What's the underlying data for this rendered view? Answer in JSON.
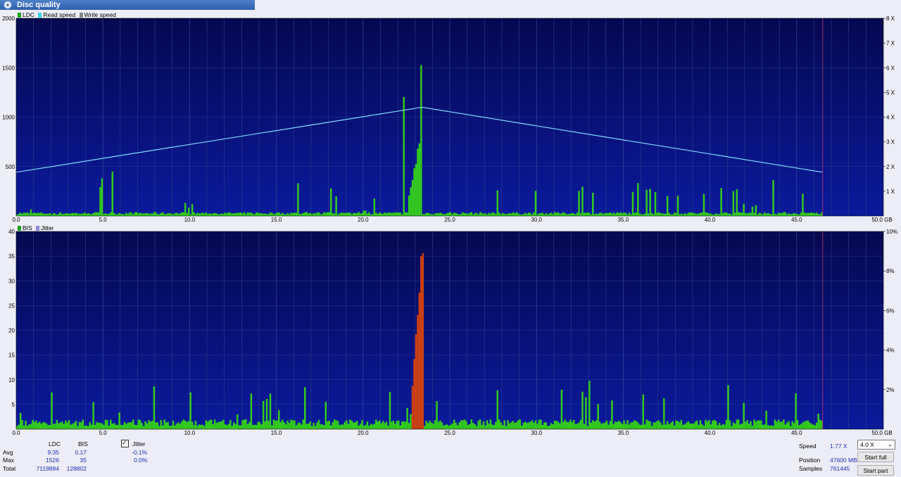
{
  "window": {
    "title": "Disc quality"
  },
  "top_legend": [
    {
      "label": "LDC",
      "color": "#1fa31f"
    },
    {
      "label": "Read speed",
      "color": "#35d6e8"
    },
    {
      "label": "Write speed",
      "color": "#888888"
    }
  ],
  "bottom_legend": [
    {
      "label": "BIS",
      "color": "#1fa31f"
    },
    {
      "label": "Jitter",
      "color": "#8a8ae0"
    }
  ],
  "colors": {
    "plot_bg_top": "#050850",
    "plot_bg_bottom": "#0a1a9c",
    "bars": "#33cc1c",
    "bars_hi": "#d04010",
    "read_line": "#7fdfff",
    "grid": "#2a3f8a",
    "end_marker": "#a0306a"
  },
  "chart_data": [
    {
      "type": "bar",
      "title": "",
      "series": [
        {
          "name": "LDC",
          "values_sampled": [
            80,
            20,
            60,
            30,
            470,
            40,
            60,
            30,
            150,
            40,
            50,
            30,
            40,
            410,
            50,
            380,
            60,
            300,
            1526,
            830,
            340,
            60,
            430,
            330,
            70,
            430,
            100,
            310,
            380,
            250,
            380,
            330,
            260,
            330,
            320,
            180,
            380,
            280,
            50
          ]
        },
        {
          "name": "Read speed",
          "x": [
            0,
            23.4,
            46.5
          ],
          "y": [
            1.77,
            4.4,
            1.77
          ]
        }
      ],
      "x_ticks": [
        "0.0",
        "5.0",
        "10.0",
        "15.0",
        "20.0",
        "25.0",
        "30.0",
        "35.0",
        "40.0",
        "45.0",
        "50.0 GB"
      ],
      "y_ticks_left": [
        "500",
        "1000",
        "1500",
        "2000"
      ],
      "y_ticks_right": [
        "1 X",
        "2 X",
        "3 X",
        "4 X",
        "5 X",
        "6 X",
        "7 X",
        "8 X"
      ],
      "xlim": [
        0,
        50
      ],
      "ylim": [
        0,
        2000
      ],
      "y2lim": [
        0,
        8
      ],
      "data_end_gb": 46.5
    },
    {
      "type": "bar",
      "title": "",
      "series": [
        {
          "name": "BIS",
          "peak": {
            "x": 23.3,
            "value": 35
          }
        }
      ],
      "x_ticks": [
        "0.0",
        "5.0",
        "10.0",
        "15.0",
        "20.0",
        "25.0",
        "30.0",
        "35.0",
        "40.0",
        "45.0",
        "50.0 GB"
      ],
      "y_ticks_left": [
        "5",
        "10",
        "15",
        "20",
        "25",
        "30",
        "35",
        "40"
      ],
      "y_ticks_right": [
        "2%",
        "4%",
        "6%",
        "8%",
        "10%"
      ],
      "xlim": [
        0,
        50
      ],
      "ylim": [
        0,
        40
      ],
      "y2lim": [
        0,
        10
      ],
      "data_end_gb": 46.5
    }
  ],
  "stats": {
    "headers": {
      "ldc": "LDC",
      "bis": "BIS"
    },
    "rows": [
      {
        "label": "Avg",
        "ldc": "9.35",
        "bis": "0.17",
        "jitter": "-0.1%"
      },
      {
        "label": "Max",
        "ldc": "1526",
        "bis": "35",
        "jitter": "0.0%"
      },
      {
        "label": "Total",
        "ldc": "7119894",
        "bis": "128802",
        "jitter": ""
      }
    ]
  },
  "jitter_checkbox": {
    "label": "Jitter",
    "checked": true
  },
  "right_panel": {
    "speed_label": "Speed",
    "speed_value": "1.77 X",
    "speed_select": "4.0 X",
    "position_label": "Position",
    "position_value": "47600 MB",
    "samples_label": "Samples",
    "samples_value": "761445",
    "start_full": "Start full",
    "start_part": "Start part"
  }
}
